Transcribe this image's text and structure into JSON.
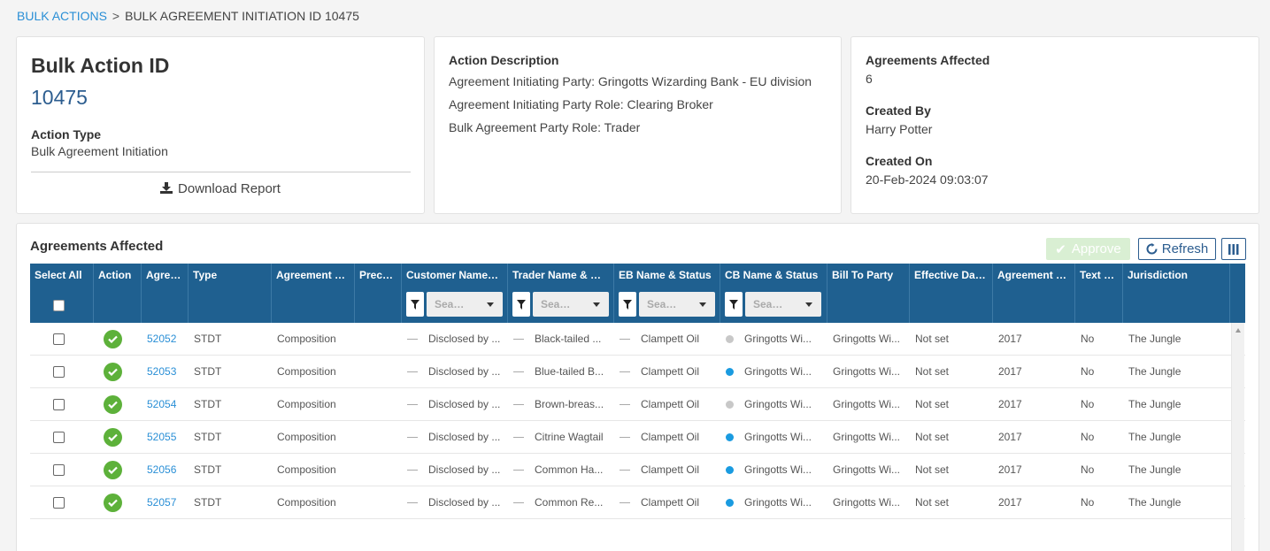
{
  "breadcrumb": {
    "parent": "BULK ACTIONS",
    "separator": ">",
    "current": "BULK AGREEMENT INITIATION ID 10475"
  },
  "summary": {
    "title": "Bulk Action ID",
    "id": "10475",
    "action_type_label": "Action Type",
    "action_type_value": "Bulk Agreement Initiation",
    "download_label": "Download Report"
  },
  "description": {
    "label": "Action Description",
    "lines": [
      "Agreement Initiating Party: Gringotts Wizarding Bank - EU division",
      "Agreement Initiating Party Role: Clearing Broker",
      "Bulk Agreement Party Role: Trader"
    ]
  },
  "meta": {
    "affected_label": "Agreements Affected",
    "affected_value": "6",
    "created_by_label": "Created By",
    "created_by_value": "Harry Potter",
    "created_on_label": "Created On",
    "created_on_value": "20-Feb-2024 09:03:07"
  },
  "table": {
    "title": "Agreements Affected",
    "approve_label": "Approve",
    "refresh_label": "Refresh",
    "columns": [
      "Select All",
      "Action",
      "Agre…",
      "Type",
      "Agreement …",
      "Prec…",
      "Customer Name…",
      "Trader Name & …",
      "EB Name & Status",
      "CB Name & Status",
      "Bill To Party",
      "Effective Da…",
      "Agreement …",
      "Text …",
      "Jurisdiction"
    ],
    "filter_placeholder": "Sea…",
    "rows": [
      {
        "id": "52052",
        "type": "STDT",
        "agreement": "Composition",
        "customer": "Disclosed by ...",
        "trader": "Black-tailed ...",
        "eb": "Clampett Oil",
        "cb": "Gringotts Wi...",
        "cb_status": "grey",
        "bill_to": "Gringotts Wi...",
        "effective": "Not set",
        "agreement_year": "2017",
        "text": "No",
        "jurisdiction": "The Jungle"
      },
      {
        "id": "52053",
        "type": "STDT",
        "agreement": "Composition",
        "customer": "Disclosed by ...",
        "trader": "Blue-tailed B...",
        "eb": "Clampett Oil",
        "cb": "Gringotts Wi...",
        "cb_status": "blue",
        "bill_to": "Gringotts Wi...",
        "effective": "Not set",
        "agreement_year": "2017",
        "text": "No",
        "jurisdiction": "The Jungle"
      },
      {
        "id": "52054",
        "type": "STDT",
        "agreement": "Composition",
        "customer": "Disclosed by ...",
        "trader": "Brown-breas...",
        "eb": "Clampett Oil",
        "cb": "Gringotts Wi...",
        "cb_status": "grey",
        "bill_to": "Gringotts Wi...",
        "effective": "Not set",
        "agreement_year": "2017",
        "text": "No",
        "jurisdiction": "The Jungle"
      },
      {
        "id": "52055",
        "type": "STDT",
        "agreement": "Composition",
        "customer": "Disclosed by ...",
        "trader": "Citrine Wagtail",
        "eb": "Clampett Oil",
        "cb": "Gringotts Wi...",
        "cb_status": "blue",
        "bill_to": "Gringotts Wi...",
        "effective": "Not set",
        "agreement_year": "2017",
        "text": "No",
        "jurisdiction": "The Jungle"
      },
      {
        "id": "52056",
        "type": "STDT",
        "agreement": "Composition",
        "customer": "Disclosed by ...",
        "trader": "Common Ha...",
        "eb": "Clampett Oil",
        "cb": "Gringotts Wi...",
        "cb_status": "blue",
        "bill_to": "Gringotts Wi...",
        "effective": "Not set",
        "agreement_year": "2017",
        "text": "No",
        "jurisdiction": "The Jungle"
      },
      {
        "id": "52057",
        "type": "STDT",
        "agreement": "Composition",
        "customer": "Disclosed by ...",
        "trader": "Common Re...",
        "eb": "Clampett Oil",
        "cb": "Gringotts Wi...",
        "cb_status": "blue",
        "bill_to": "Gringotts Wi...",
        "effective": "Not set",
        "agreement_year": "2017",
        "text": "No",
        "jurisdiction": "The Jungle"
      }
    ]
  },
  "colors": {
    "link": "#2a8fd6",
    "header": "#1f6090",
    "ok": "#5db13a",
    "status_blue": "#1a9be0",
    "status_grey": "#c8c8c8"
  }
}
